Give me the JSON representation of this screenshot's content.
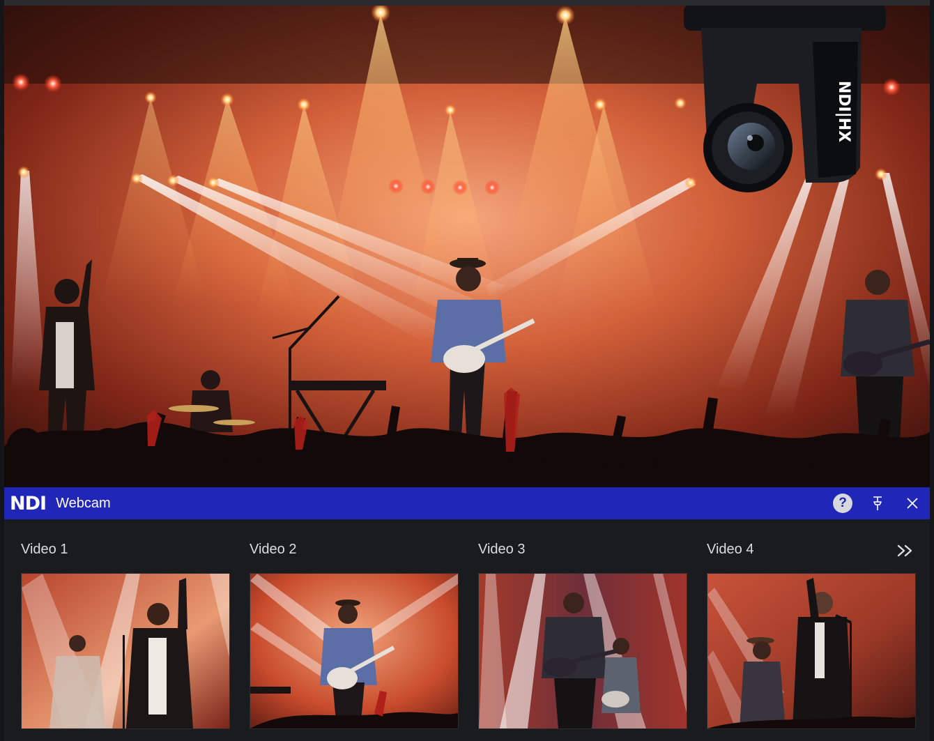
{
  "window": {
    "logo_text": "NDI",
    "title": "Webcam"
  },
  "hero": {
    "camera_badge": "NDI|HX"
  },
  "videos": [
    {
      "label": "Video 1"
    },
    {
      "label": "Video 2"
    },
    {
      "label": "Video 3"
    },
    {
      "label": "Video 4"
    }
  ],
  "icons": {
    "help": "help-icon",
    "pin": "pin-icon",
    "close": "close-icon",
    "more": "double-chevron-right-icon"
  },
  "colors": {
    "titlebar": "#2027b8",
    "background": "#1a1b1f",
    "label": "#dddde0"
  }
}
